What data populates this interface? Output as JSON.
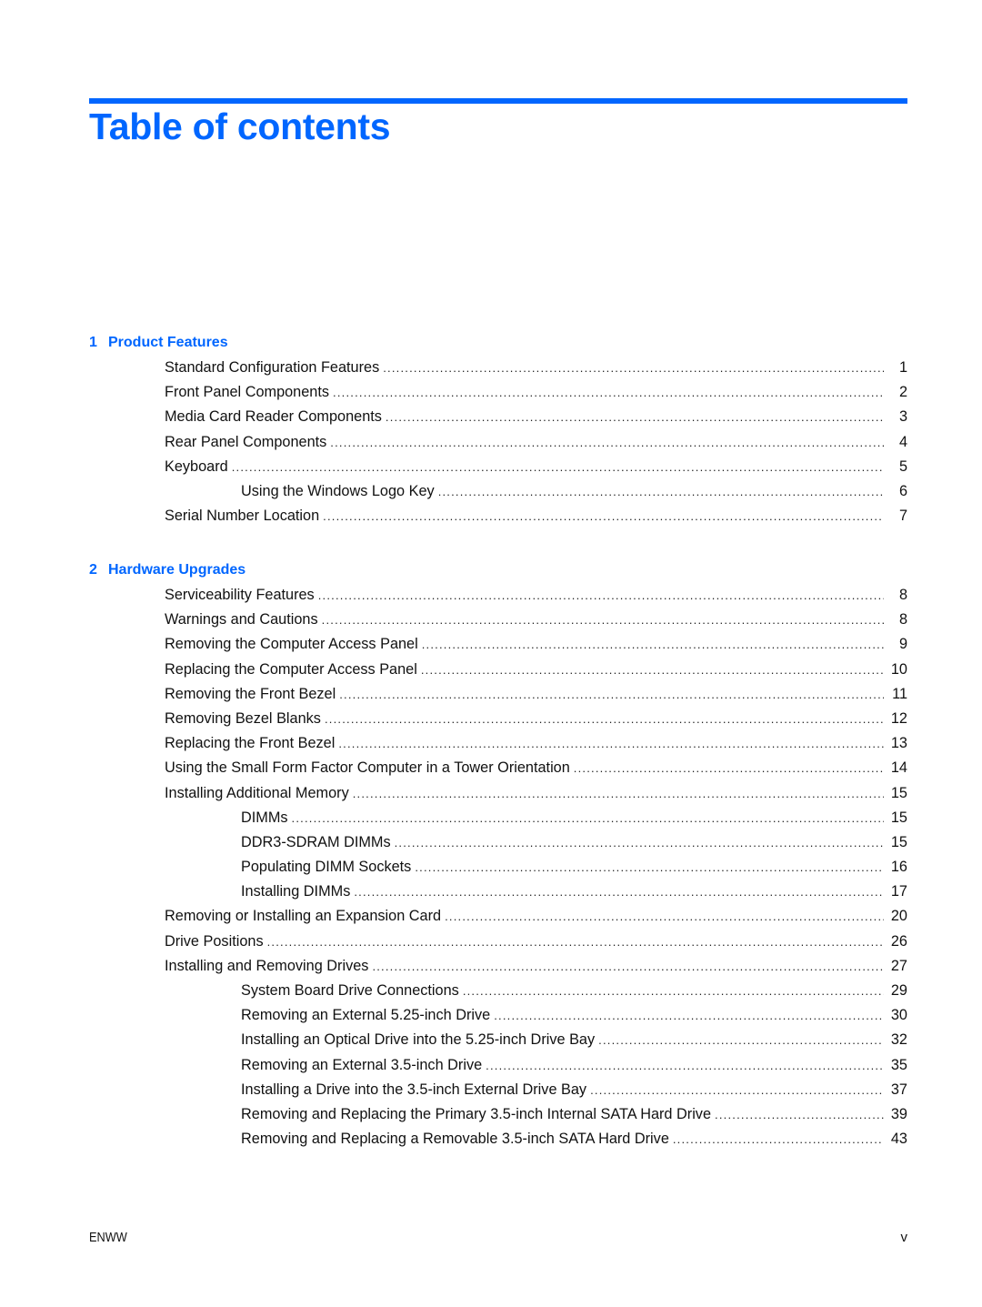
{
  "document": {
    "title": "Table of contents",
    "accent_color": "#0066ff"
  },
  "chapters": [
    {
      "number": "1",
      "title": "Product Features",
      "entries": [
        {
          "title": "Standard Configuration Features",
          "page": "1",
          "level": 1
        },
        {
          "title": "Front Panel Components",
          "page": "2",
          "level": 1
        },
        {
          "title": "Media Card Reader Components",
          "page": "3",
          "level": 1
        },
        {
          "title": "Rear Panel Components",
          "page": "4",
          "level": 1
        },
        {
          "title": "Keyboard",
          "page": "5",
          "level": 1
        },
        {
          "title": "Using the Windows Logo Key",
          "page": "6",
          "level": 2
        },
        {
          "title": "Serial Number Location",
          "page": "7",
          "level": 1
        }
      ]
    },
    {
      "number": "2",
      "title": "Hardware Upgrades",
      "entries": [
        {
          "title": "Serviceability Features",
          "page": "8",
          "level": 1
        },
        {
          "title": "Warnings and Cautions",
          "page": "8",
          "level": 1
        },
        {
          "title": "Removing the Computer Access Panel",
          "page": "9",
          "level": 1
        },
        {
          "title": "Replacing the Computer Access Panel",
          "page": "10",
          "level": 1
        },
        {
          "title": "Removing the Front Bezel",
          "page": "11",
          "level": 1
        },
        {
          "title": "Removing Bezel Blanks",
          "page": "12",
          "level": 1
        },
        {
          "title": "Replacing the Front Bezel",
          "page": "13",
          "level": 1
        },
        {
          "title": "Using the Small Form Factor Computer in a Tower Orientation",
          "page": "14",
          "level": 1
        },
        {
          "title": "Installing Additional Memory",
          "page": "15",
          "level": 1
        },
        {
          "title": "DIMMs",
          "page": "15",
          "level": 2
        },
        {
          "title": "DDR3-SDRAM DIMMs",
          "page": "15",
          "level": 2
        },
        {
          "title": "Populating DIMM Sockets",
          "page": "16",
          "level": 2
        },
        {
          "title": "Installing DIMMs",
          "page": "17",
          "level": 2
        },
        {
          "title": "Removing or Installing an Expansion Card",
          "page": "20",
          "level": 1
        },
        {
          "title": "Drive Positions",
          "page": "26",
          "level": 1
        },
        {
          "title": "Installing and Removing Drives",
          "page": "27",
          "level": 1
        },
        {
          "title": "System Board Drive Connections",
          "page": "29",
          "level": 2
        },
        {
          "title": "Removing an External 5.25-inch Drive",
          "page": "30",
          "level": 2
        },
        {
          "title": "Installing an Optical Drive into the 5.25-inch Drive Bay",
          "page": "32",
          "level": 2
        },
        {
          "title": "Removing an External 3.5-inch Drive",
          "page": "35",
          "level": 2
        },
        {
          "title": "Installing a Drive into the 3.5-inch External Drive Bay",
          "page": "37",
          "level": 2
        },
        {
          "title": "Removing and Replacing the Primary 3.5-inch Internal SATA Hard Drive",
          "page": "39",
          "level": 2
        },
        {
          "title": "Removing and Replacing a Removable 3.5-inch SATA Hard Drive",
          "page": "43",
          "level": 2
        }
      ]
    }
  ],
  "footer": {
    "left": "ENWW",
    "right": "v"
  }
}
